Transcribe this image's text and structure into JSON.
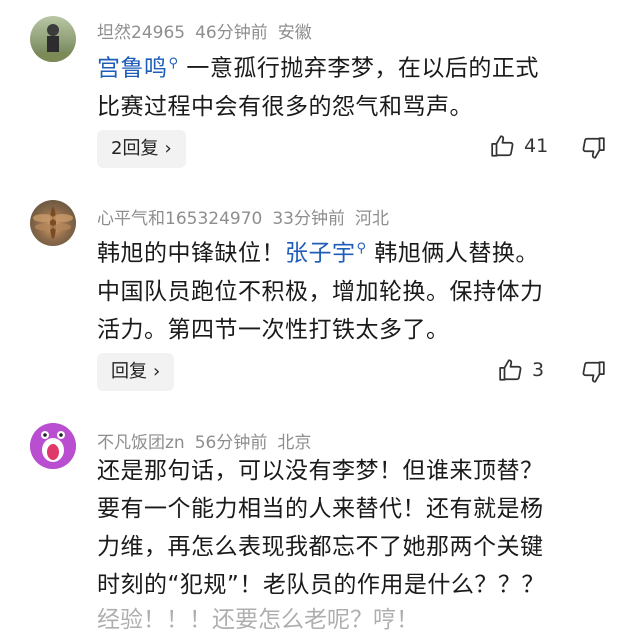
{
  "comments": [
    {
      "username": "坦然24965",
      "time": "46分钟前",
      "location": "安徽",
      "mention": "宫鲁鸣",
      "text_after_mention": " 一意孤行抛弃李梦，在以后的正式",
      "text_line2": "比赛过程中会有很多的怨气和骂声。",
      "reply_label": "2回复",
      "like_count": "41"
    },
    {
      "username": "心平气和165324970",
      "time": "33分钟前",
      "location": "河北",
      "text_before_mention": "韩旭的中锋缺位！",
      "mention": "张子宇",
      "text_after_mention": " 韩旭俩人替换。",
      "text_line2": "中国队员跑位不积极，增加轮换。保持体力",
      "text_line3": "活力。第四节一次性打铁太多了。",
      "reply_label": "回复",
      "like_count": "3"
    },
    {
      "username": "不凡饭团zn",
      "time": "56分钟前",
      "location": "北京",
      "lines": [
        "还是那句话，可以没有李梦！但谁来顶替？",
        "要有一个能力相当的人来替代！还有就是杨",
        "力维，再怎么表现我都忘不了她那两个关键",
        "时刻的“犯规”！老队员的作用是什么？？？"
      ],
      "partial_line": "经验！！！还要怎么老呢？哼！"
    }
  ],
  "icons": {
    "like": "thumbs-up-icon",
    "dislike": "thumbs-down-icon",
    "mention": "search-icon"
  },
  "colors": {
    "mention": "#1f5eb8",
    "meta": "#8e8e8e",
    "reply_bg": "#f2f2f2"
  }
}
